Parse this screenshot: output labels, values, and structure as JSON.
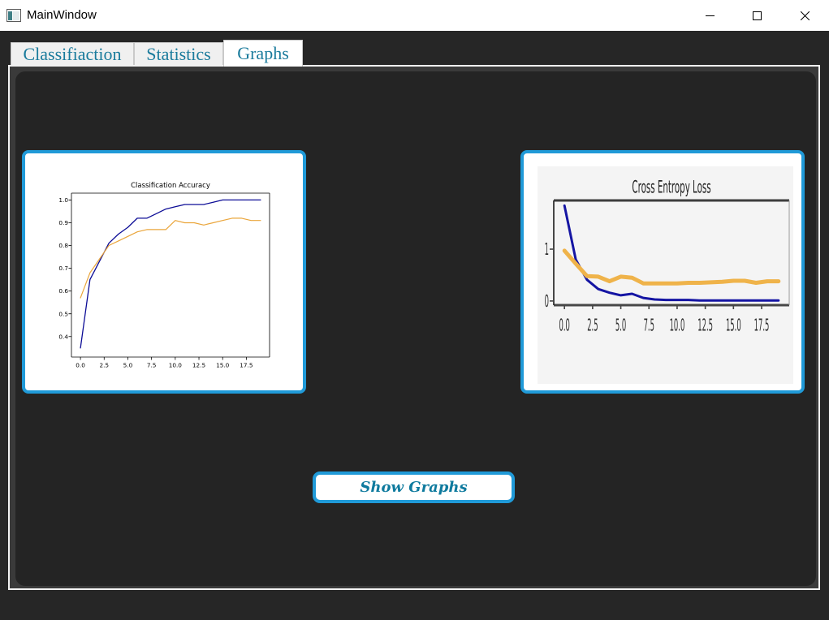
{
  "window": {
    "title": "MainWindow",
    "icon": "app-window-icon",
    "controls": [
      "minimize-icon",
      "maximize-icon",
      "close-icon"
    ]
  },
  "tabs": [
    {
      "label": "Classifiaction",
      "selected": false
    },
    {
      "label": "Statistics",
      "selected": false
    },
    {
      "label": "Graphs",
      "selected": true
    }
  ],
  "graphs_page": {
    "show_graphs_button": "Show Graphs"
  },
  "colors": {
    "window_background": "#262626",
    "panel_background": "#242424",
    "accent_border": "#209ad8",
    "tab_text": "#1a7b9c",
    "button_text": "#0e7a9e"
  },
  "chart_data": [
    {
      "type": "line",
      "title": "Classification Accuracy",
      "xlabel": "",
      "ylabel": "",
      "x": [
        0,
        1,
        2,
        3,
        4,
        5,
        6,
        7,
        8,
        9,
        10,
        11,
        12,
        13,
        14,
        15,
        16,
        17,
        18,
        19
      ],
      "series": [
        {
          "color": "#0c0c96",
          "values": [
            0.35,
            0.65,
            0.73,
            0.81,
            0.85,
            0.88,
            0.92,
            0.92,
            0.94,
            0.96,
            0.97,
            0.98,
            0.98,
            0.98,
            0.99,
            1.0,
            1.0,
            1.0,
            1.0,
            1.0
          ]
        },
        {
          "color": "#eaa53a",
          "values": [
            0.57,
            0.68,
            0.74,
            0.8,
            0.82,
            0.84,
            0.86,
            0.87,
            0.87,
            0.87,
            0.91,
            0.9,
            0.9,
            0.89,
            0.9,
            0.91,
            0.92,
            0.92,
            0.91,
            0.91
          ]
        }
      ],
      "xlim": [
        -0.95,
        19.95
      ],
      "ylim": [
        0.31,
        1.03
      ],
      "xticks": [
        0,
        2.5,
        5,
        7.5,
        10,
        12.5,
        15,
        17.5
      ],
      "xtick_labels": [
        "0.0",
        "2.5",
        "5.0",
        "7.5",
        "10.0",
        "12.5",
        "15.0",
        "17.5"
      ],
      "yticks": [
        0.4,
        0.5,
        0.6,
        0.7,
        0.8,
        0.9,
        1.0
      ],
      "ytick_labels": [
        "0.4",
        "0.5",
        "0.6",
        "0.7",
        "0.8",
        "0.9",
        "1.0"
      ],
      "grid": false
    },
    {
      "type": "line",
      "title": "Cross Entropy Loss",
      "xlabel": "",
      "ylabel": "",
      "x": [
        0,
        1,
        2,
        3,
        4,
        5,
        6,
        7,
        8,
        9,
        10,
        11,
        12,
        13,
        14,
        15,
        16,
        17,
        18,
        19
      ],
      "series": [
        {
          "color": "#1515a3",
          "values": [
            1.84,
            0.8,
            0.41,
            0.23,
            0.16,
            0.11,
            0.14,
            0.06,
            0.03,
            0.02,
            0.02,
            0.02,
            0.01,
            0.01,
            0.01,
            0.01,
            0.01,
            0.01,
            0.01,
            0.01
          ]
        },
        {
          "color": "#efb34a",
          "values": [
            0.97,
            0.72,
            0.48,
            0.47,
            0.38,
            0.47,
            0.45,
            0.34,
            0.34,
            0.34,
            0.34,
            0.35,
            0.35,
            0.36,
            0.37,
            0.39,
            0.39,
            0.35,
            0.38,
            0.38
          ]
        }
      ],
      "xlim": [
        -0.95,
        19.95
      ],
      "ylim": [
        -0.08,
        1.94
      ],
      "xticks": [
        0,
        2.5,
        5,
        7.5,
        10,
        12.5,
        15,
        17.5
      ],
      "xtick_labels": [
        "0.0",
        "2.5",
        "5.0",
        "7.5",
        "10.0",
        "12.5",
        "15.0",
        "17.5"
      ],
      "yticks": [
        0,
        1
      ],
      "ytick_labels": [
        "0",
        "1"
      ],
      "grid": false
    }
  ]
}
